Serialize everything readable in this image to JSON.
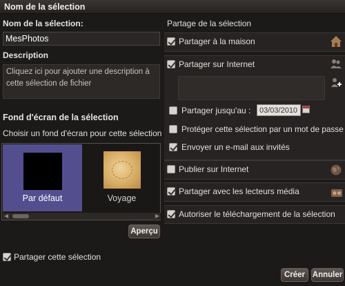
{
  "window": {
    "title": "Nom de la sélection"
  },
  "left": {
    "name_label": "Nom de la sélection:",
    "name_value": "MesPhotos",
    "description_label": "Description",
    "description_placeholder": "Cliquez ici pour ajouter une description à\ncette sélection de fichier",
    "wallpaper_title": "Fond d'écran de la sélection",
    "wallpaper_subtitle": "Choisir un fond d'écran pour cette sélection",
    "wallpapers": [
      {
        "label": "Par défaut",
        "selected": true
      },
      {
        "label": "Voyage",
        "selected": false
      }
    ],
    "preview_button": "Aperçu",
    "share_selection_label": "Partager cette sélection",
    "share_selection_checked": true
  },
  "right": {
    "title": "Partage de la sélection",
    "options": {
      "home": {
        "label": "Partager à la maison",
        "checked": true,
        "icon": "house-icon"
      },
      "internet": {
        "label": "Partager sur Internet",
        "checked": true,
        "icon": "people-icon"
      },
      "until": {
        "label": "Partager jusqu'au :",
        "checked": false,
        "date": "03/03/2010"
      },
      "password": {
        "label": "Protéger cette sélection par un mot de passe",
        "checked": false
      },
      "email": {
        "label": "Envoyer un e-mail aux invités",
        "checked": true
      },
      "publish": {
        "label": "Publier sur Internet",
        "checked": false,
        "icon": "globe-icon"
      },
      "media": {
        "label": "Partager avec les lecteurs média",
        "checked": true,
        "icon": "media-player-icon"
      },
      "download": {
        "label": "Autoriser le téléchargement de la sélection",
        "checked": true
      }
    }
  },
  "footer": {
    "create_button": "Créer",
    "cancel_button": "Annuler"
  },
  "colors": {
    "selected_thumb": "#534f8f",
    "background": "#1c1a19"
  }
}
